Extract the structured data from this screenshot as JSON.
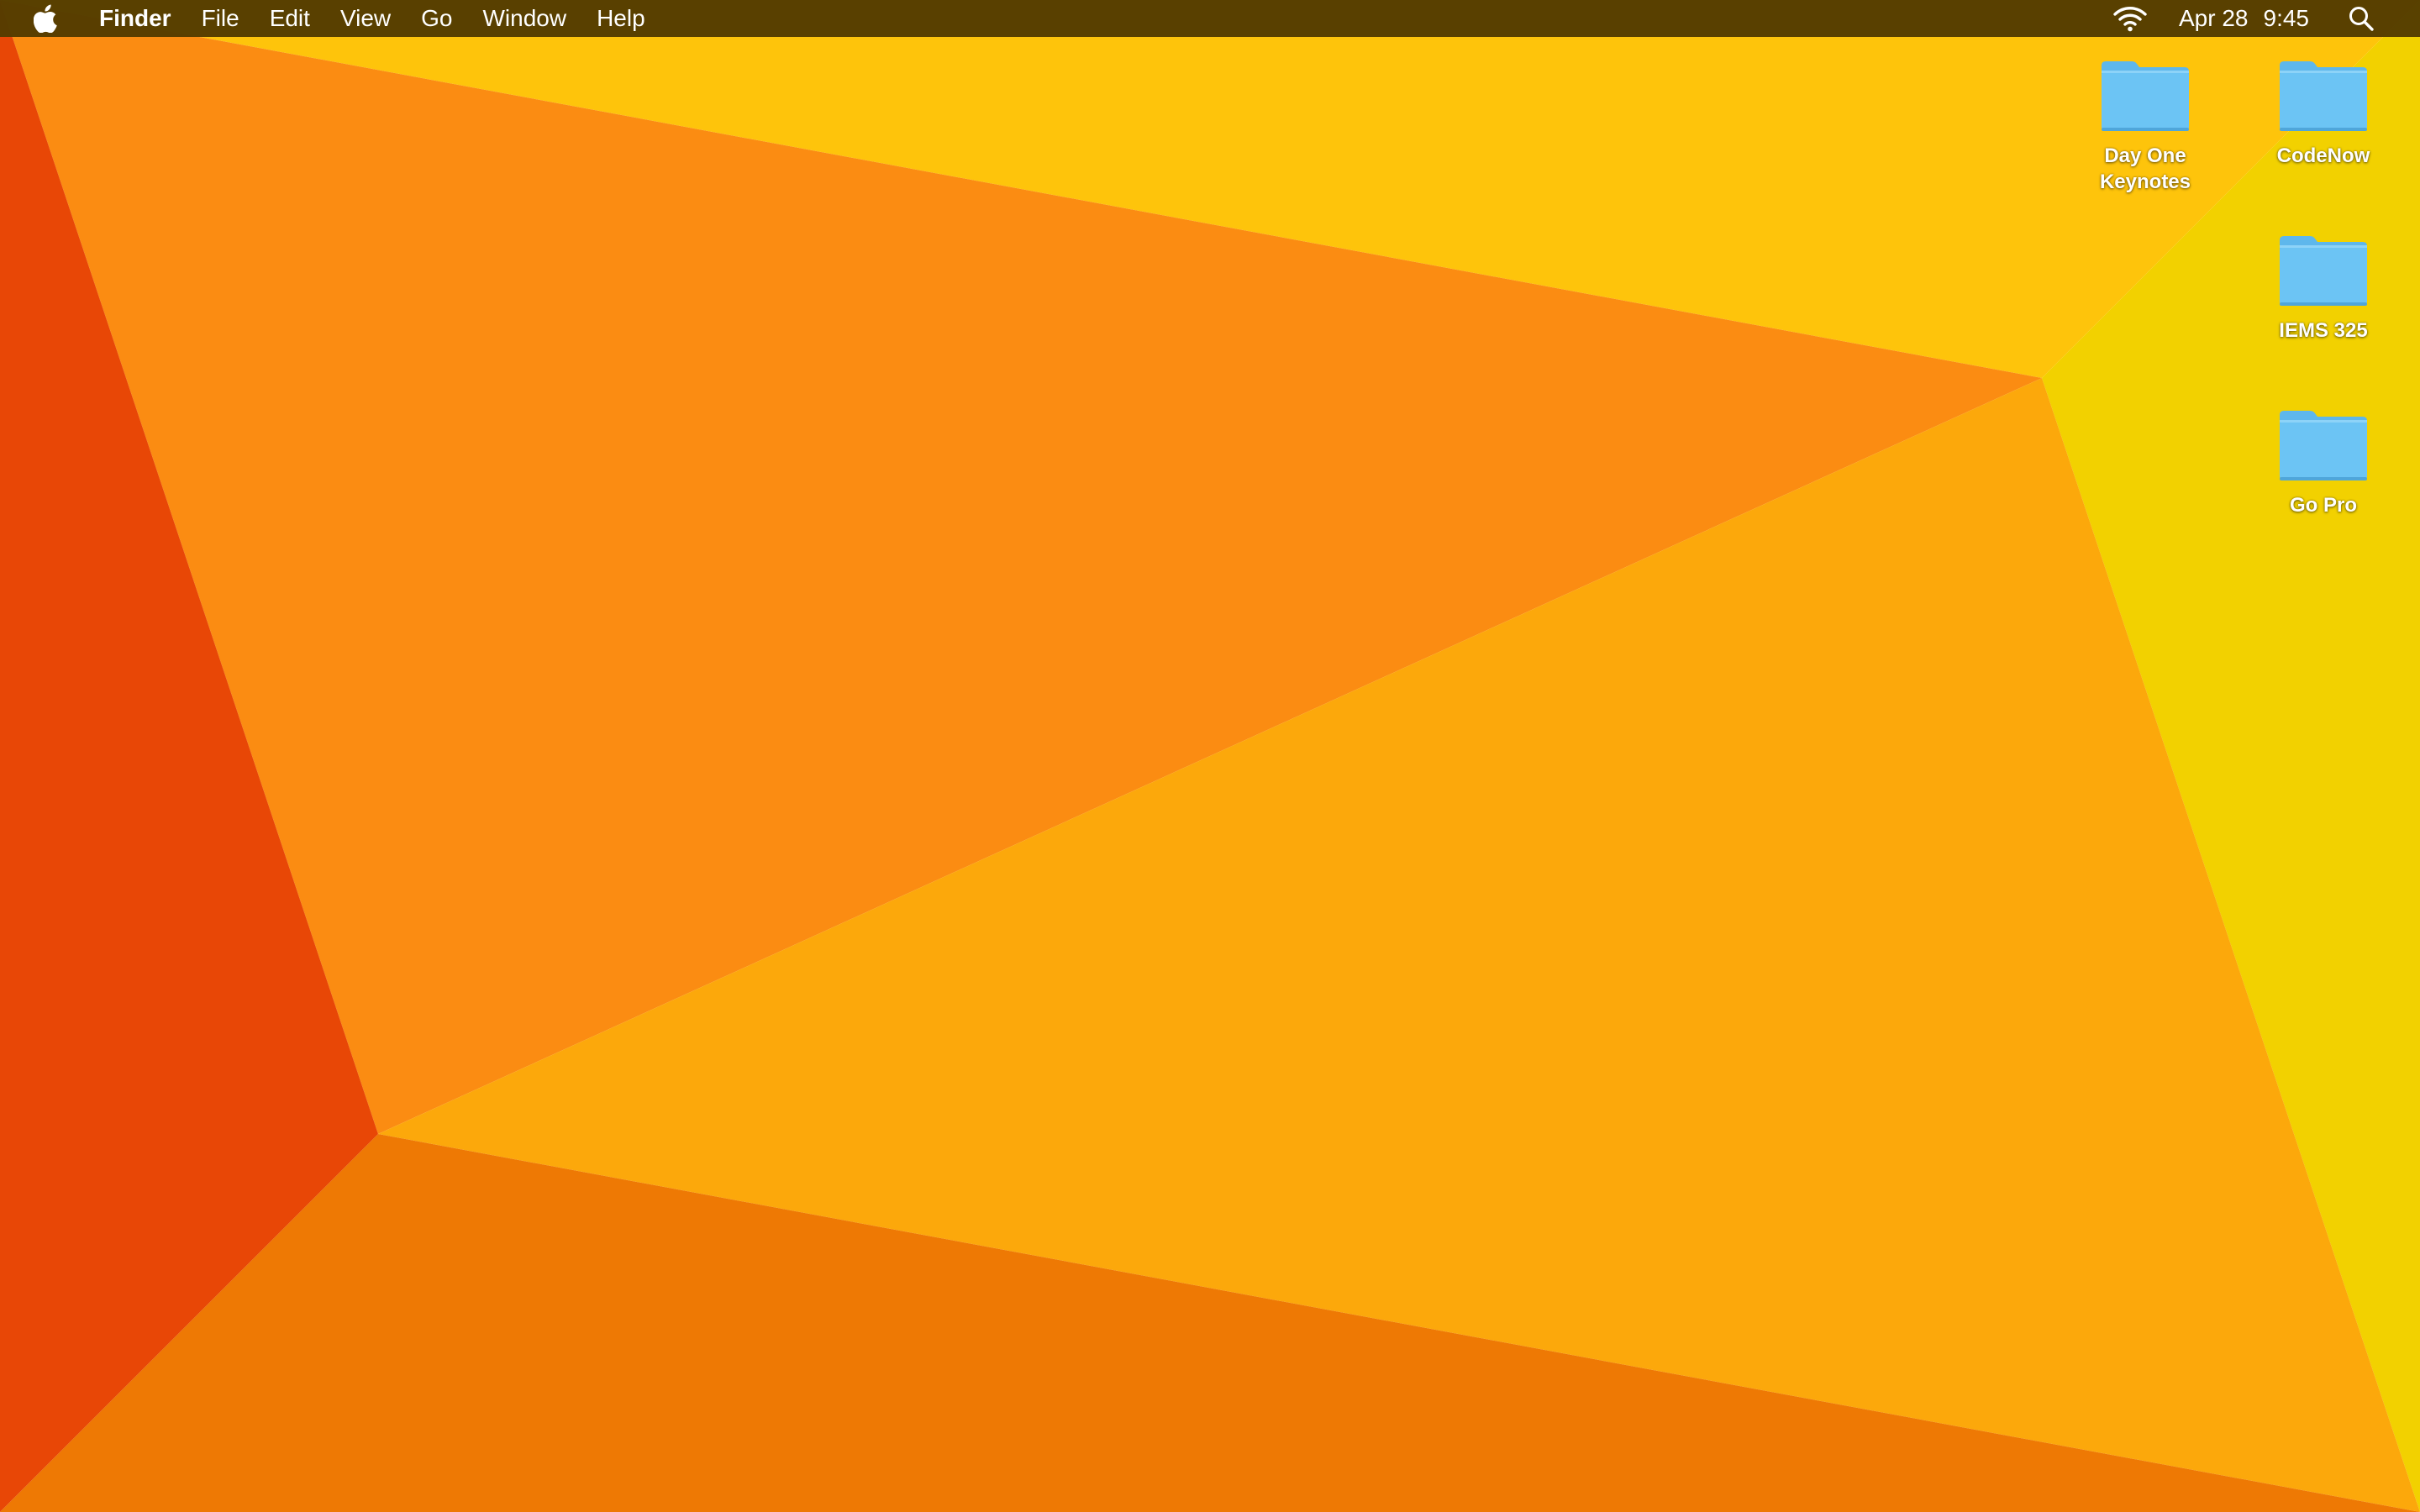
{
  "menubar": {
    "apple_icon": "apple-logo-icon",
    "app_name": "Finder",
    "menus": [
      "File",
      "Edit",
      "View",
      "Go",
      "Window",
      "Help"
    ],
    "status": {
      "wifi_icon": "wifi-icon",
      "date": "Apr 28",
      "time": "9:45",
      "spotlight_icon": "search-icon"
    },
    "background": "#543C00"
  },
  "desktop": {
    "icons": [
      {
        "label": "Day One\nKeynotes",
        "icon": "folder-icon"
      },
      {
        "label": "CodeNow",
        "icon": "folder-icon"
      },
      {
        "label": "IEMS 325",
        "icon": "folder-icon"
      },
      {
        "label": "Go Pro",
        "icon": "folder-icon"
      }
    ],
    "wallpaper_colors": {
      "red": "#E84706",
      "deep_orange": "#EE7904",
      "orange": "#FB8C12",
      "amber": "#FCA80B",
      "gold": "#FEC40B",
      "yellow": "#F2D100"
    },
    "folder_color": "#6CC4F4"
  }
}
